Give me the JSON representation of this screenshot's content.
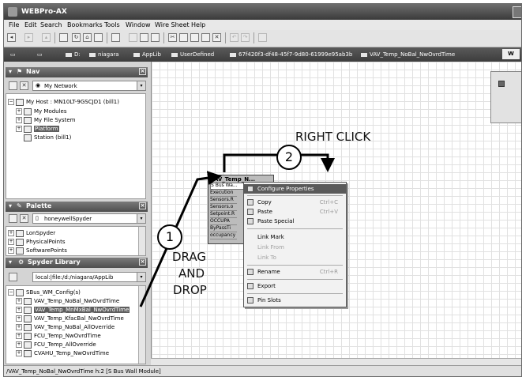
{
  "window": {
    "title": "WEBPro-AX"
  },
  "menu": [
    "File",
    "Edit",
    "Search",
    "Bookmarks",
    "Tools",
    "Window",
    "Wire Sheet",
    "Help"
  ],
  "pathbar": {
    "items": [
      "D:",
      "niagara",
      "AppLib",
      "UserDefined",
      "67f420f3-df48-45f7-9d80-61999e95ab3b",
      "VAV_Temp_NoBal_NwOvrdTime"
    ],
    "end_tab": "W"
  },
  "nav": {
    "title": "Nav",
    "network_select": "My Network",
    "tree": [
      {
        "label": "My Host : MN10LT-9GSCJD1 (bill1)",
        "expander": "−"
      },
      {
        "label": "My Modules",
        "expander": "+"
      },
      {
        "label": "My File System",
        "expander": "+"
      },
      {
        "label": "Platform",
        "expander": "+",
        "selected": true
      },
      {
        "label": "Station (bill1)",
        "expander": ""
      }
    ]
  },
  "palette": {
    "title": "Palette",
    "select": "honeywellSpyder",
    "items": [
      "LonSpyder",
      "PhysicalPoints",
      "SoftwarePoints"
    ]
  },
  "spyder_library": {
    "title": "Spyder Library",
    "path": "local:|file:/d:/niagara/AppLib",
    "root": "SBus_WM_Config(s)",
    "items": [
      {
        "label": "VAV_Temp_NoBal_NwOvrdTime"
      },
      {
        "label": "VAV_Temp_MnMxBal_NwOvrdTime",
        "selected": true
      },
      {
        "label": "VAV_Temp_KfacBal_NwOvrdTime"
      },
      {
        "label": "VAV_Temp_NoBal_AllOverride"
      },
      {
        "label": "FCU_Temp_NwOvrdTime"
      },
      {
        "label": "FCU_Temp_AllOverride"
      },
      {
        "label": "CVAHU_Temp_NwOvrdTime"
      }
    ]
  },
  "component": {
    "title": "VAV_Temp_N...",
    "subtitle": "S Bus Wa...",
    "slots": [
      "Execution",
      "Sensors.R",
      "Sensors.o",
      "Setpoint.R",
      "OCCUPA",
      "ByPassTi",
      "occupancy"
    ]
  },
  "context_menu": {
    "items": [
      {
        "label": "Configure Properties",
        "shortcut": "",
        "highlighted": true
      },
      {
        "label": "Copy",
        "shortcut": "Ctrl+C"
      },
      {
        "label": "Paste",
        "shortcut": "Ctrl+V"
      },
      {
        "label": "Paste Special",
        "shortcut": ""
      },
      {
        "label": "Link Mark",
        "shortcut": ""
      },
      {
        "label": "Link From",
        "shortcut": "",
        "disabled": true
      },
      {
        "label": "Link To",
        "shortcut": "",
        "disabled": true
      },
      {
        "label": "Rename",
        "shortcut": "Ctrl+R"
      },
      {
        "label": "Export",
        "shortcut": ""
      },
      {
        "label": "Pin Slots",
        "shortcut": ""
      }
    ]
  },
  "annotations": {
    "step1": "1",
    "step2": "2",
    "right_click": "RIGHT CLICK",
    "drag_line1": "DRAG",
    "drag_line2": "AND",
    "drag_line3": "DROP"
  },
  "status": "/VAV_Temp_NoBal_NwOvrdTime h:2 [S Bus Wall Module]"
}
